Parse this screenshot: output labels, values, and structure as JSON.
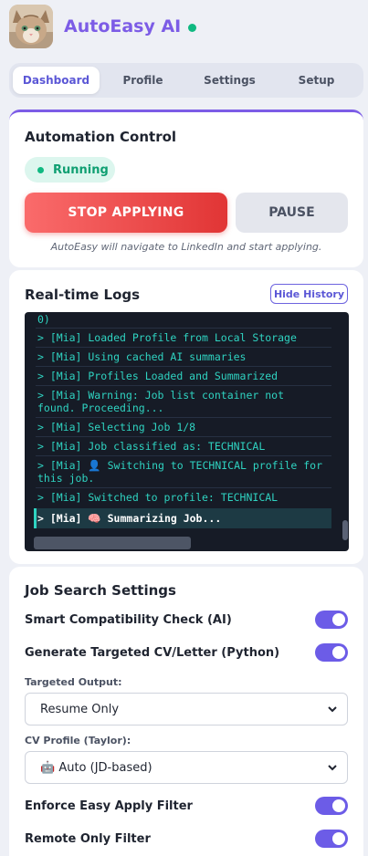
{
  "header": {
    "title": "AutoEasy AI",
    "status_color": "#10b981"
  },
  "tabs": [
    {
      "label": "Dashboard",
      "active": true
    },
    {
      "label": "Profile"
    },
    {
      "label": "Settings"
    },
    {
      "label": "Setup"
    }
  ],
  "automation": {
    "title": "Automation Control",
    "status": "Running",
    "stop_label": "STOP APPLYING",
    "pause_label": "PAUSE",
    "note": "AutoEasy will navigate to LinkedIn and start applying."
  },
  "logs": {
    "title": "Real-time Logs",
    "history_button": "Hide History",
    "lines": [
      "0)",
      "> [Mia] Loaded Profile from Local Storage",
      "> [Mia] Using cached AI summaries",
      "> [Mia] Profiles Loaded and Summarized",
      "> [Mia] Warning: Job list container not found. Proceeding...",
      "> [Mia] Selecting Job 1/8",
      "> [Mia] Job classified as: TECHNICAL",
      "> [Mia] 👤 Switching to TECHNICAL profile for this job.",
      "> [Mia] Switched to profile: TECHNICAL",
      "> [Mia] 🧠 Summarizing Job..."
    ]
  },
  "job_search": {
    "title": "Job Search Settings",
    "smart_check_label": "Smart Compatibility Check (AI)",
    "smart_check_on": true,
    "generate_cv_label": "Generate Targeted CV/Letter (Python)",
    "generate_cv_on": true,
    "targeted_output_label": "Targeted Output:",
    "targeted_output_value": "Resume Only",
    "cv_profile_label": "CV Profile (Taylor):",
    "cv_profile_value": "🤖 Auto (JD-based)",
    "easy_apply_label": "Enforce Easy Apply Filter",
    "easy_apply_on": true,
    "remote_label": "Remote Only Filter",
    "remote_on": true
  },
  "colors": {
    "accent": "#6c5ce7",
    "danger": "#e13535",
    "success": "#10b981",
    "log_text": "#2fd3c1"
  }
}
